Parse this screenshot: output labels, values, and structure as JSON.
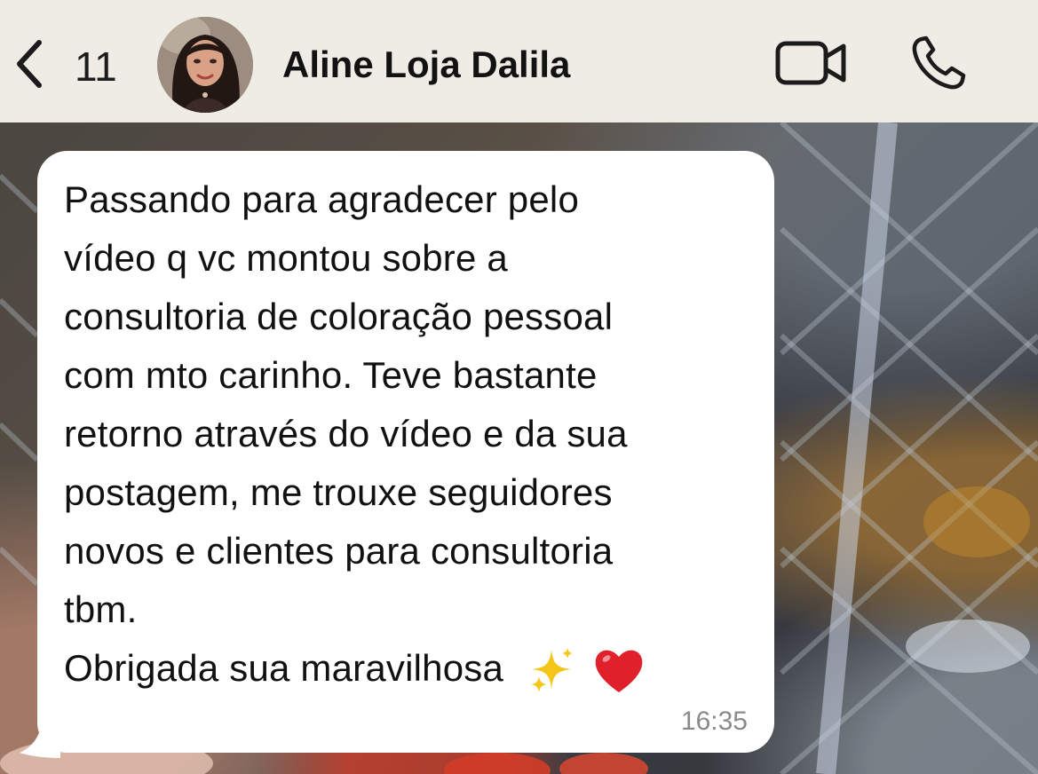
{
  "header": {
    "back_count": "11",
    "contact_name": "Aline Loja Dalila",
    "back_icon": "chevron-left-icon",
    "video_icon": "video-camera-icon",
    "call_icon": "phone-icon"
  },
  "message": {
    "lines": [
      "Passando para agradecer pelo",
      "vídeo q vc montou sobre a",
      "consultoria de coloração pessoal",
      "com mto carinho. Teve bastante",
      "retorno através do vídeo e da sua",
      "postagem, me trouxe seguidores",
      "novos e clientes para consultoria",
      "tbm.",
      "Obrigada sua maravilhosa"
    ],
    "emojis": [
      "sparkles-emoji",
      "red-heart-emoji"
    ],
    "time": "16:35"
  },
  "colors": {
    "header_bg": "#efece6",
    "bubble_bg": "#ffffff",
    "text": "#111111",
    "timestamp": "#8a8a8a"
  }
}
